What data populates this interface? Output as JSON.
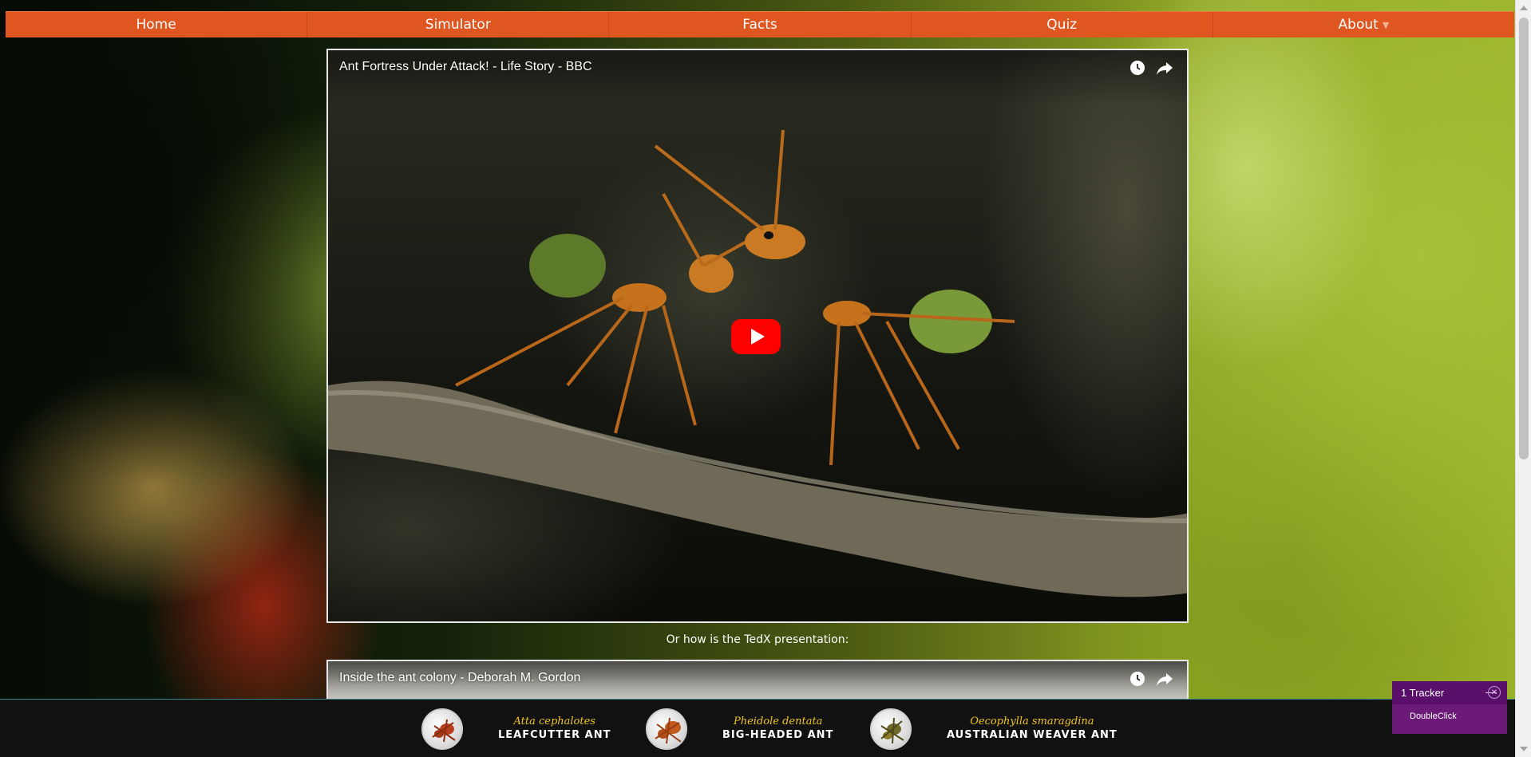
{
  "nav": {
    "items": [
      {
        "label": "Home"
      },
      {
        "label": "Simulator"
      },
      {
        "label": "Facts"
      },
      {
        "label": "Quiz"
      },
      {
        "label": "About"
      }
    ],
    "accent_color": "#e05620"
  },
  "videos": [
    {
      "title": "Ant Fortress Under Attack! - Life Story - BBC"
    },
    {
      "title": "Inside the ant colony - Deborah M. Gordon"
    }
  ],
  "between_text": "Or how is the TedX presentation:",
  "ants": [
    {
      "latin": "Atta cephalotes",
      "common": "LEAFCUTTER ANT"
    },
    {
      "latin": "Pheidole dentata",
      "common": "BIG-HEADED ANT"
    },
    {
      "latin": "Oecophylla smaragdina",
      "common": "AUSTRALIAN WEAVER ANT"
    }
  ],
  "tracker": {
    "title": "1 Tracker",
    "item": "DoubleClick",
    "color": "#6b1a78"
  },
  "icons": [
    "clock-icon",
    "share-icon",
    "play-icon",
    "chevron-down-icon",
    "close-icon"
  ]
}
